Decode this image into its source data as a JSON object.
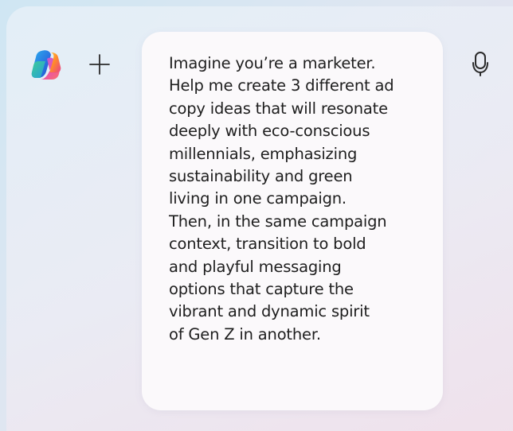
{
  "composer": {
    "logo_icon": "copilot-logo-icon",
    "add_icon": "plus-icon",
    "mic_icon": "microphone-icon",
    "prompt_text": "Imagine you’re a marketer.\nHelp me create 3 different ad\ncopy ideas that will resonate\ndeeply with eco-conscious\nmillennials, emphasizing\nsustainability and green\nliving in one campaign.\nThen, in the same campaign\ncontext, transition to bold\nand playful messaging\noptions that capture the\nvibrant and dynamic spirit\nof Gen Z in another."
  },
  "colors": {
    "card_background": "#fbf9fb",
    "text": "#1e1e1e",
    "icon": "#2b2b2b"
  }
}
